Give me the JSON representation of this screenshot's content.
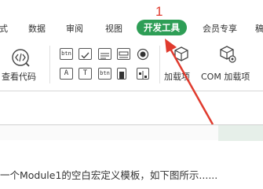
{
  "tabs": [
    {
      "label": "式"
    },
    {
      "label": "数据"
    },
    {
      "label": "审阅"
    },
    {
      "label": "视图"
    },
    {
      "label": "开发工具",
      "active": true
    },
    {
      "label": "会员专享"
    },
    {
      "label": "稿"
    }
  ],
  "annotation": {
    "number": "1",
    "color": "#e03b2e"
  },
  "ribbon": {
    "view_code_label": "查看代码",
    "addins_label": "加载项",
    "com_addins_label": "COM 加载项",
    "controls": [
      {
        "icon": "button-control-icon",
        "text": "btn"
      },
      {
        "icon": "checkbox-control-icon",
        "text": ""
      },
      {
        "icon": "combobox-control-icon",
        "text": ""
      },
      {
        "icon": "listbox-control-icon",
        "text": ""
      },
      {
        "icon": "option-button-control-icon",
        "text": ""
      },
      {
        "icon": "label-control-icon",
        "text": "A"
      },
      {
        "icon": "textbox-control-icon",
        "text": "T"
      },
      {
        "icon": "toggle-button-control-icon",
        "text": "btn"
      },
      {
        "icon": "scrollbar-control-icon",
        "text": ""
      },
      {
        "icon": "spinbutton-control-icon",
        "text": ""
      }
    ]
  },
  "caption": "一个Module1的空白宏定义模板，如下图所示......",
  "colors": {
    "accent": "#2e9e56",
    "annotation": "#e03b2e"
  }
}
